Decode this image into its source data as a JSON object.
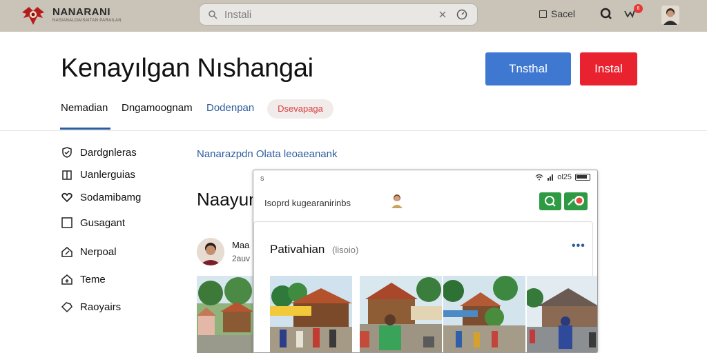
{
  "topbar": {
    "logo_text": "NANARANI",
    "logo_subtext": "NASIANALOAISAITAN PARAILAN",
    "search_placeholder": "Instali",
    "action_label": "Sacel",
    "notification_count": "6",
    "icons": [
      "logo",
      "search-icon",
      "clear-icon",
      "timer-icon",
      "document-icon",
      "zoom-icon",
      "notification-icon",
      "avatar"
    ]
  },
  "header": {
    "title": "Kenayılgan Nıshangai",
    "primary_button": "Tnsthal",
    "danger_button": "Instal"
  },
  "tabs": [
    {
      "label": "Nemadian",
      "active": true
    },
    {
      "label": "Dngamoognam",
      "active": false
    },
    {
      "label": "Dodenpan",
      "active": false
    },
    {
      "label": "Dsevapaga",
      "active": false
    }
  ],
  "sidebar": {
    "items": [
      {
        "label": "Dardgnleras",
        "icon": "shield-check-icon"
      },
      {
        "label": "Uanlerguias",
        "icon": "building-icon"
      },
      {
        "label": "Sodamibamg",
        "icon": "heart-icon"
      },
      {
        "label": "Gusagant",
        "icon": "square-icon"
      },
      {
        "label": "Nerpoal",
        "icon": "home-edit-icon"
      },
      {
        "label": "Teme",
        "icon": "home-add-icon"
      },
      {
        "label": "Raoyairs",
        "icon": "tag-icon"
      }
    ]
  },
  "main": {
    "breadcrumb": "Nanarazpdn Olata leoaeanank",
    "section_title": "Naayun",
    "post": {
      "name": "Maa",
      "meta": "2auv"
    }
  },
  "device": {
    "status_left": "s",
    "status_right": "ol25",
    "search_text": "Isoprd kugearanirinbs",
    "card": {
      "title": "Pativahian",
      "subtitle": "(lisoio)",
      "more": "•••",
      "photos": [
        "village-photo",
        "village-photo",
        "village-photo",
        "village-photo"
      ]
    }
  },
  "colors": {
    "topbar_bg": "#c9c3b8",
    "primary": "#3f78d1",
    "danger": "#e8232f",
    "accent_link": "#2d5c9e",
    "green": "#2f9a44"
  }
}
